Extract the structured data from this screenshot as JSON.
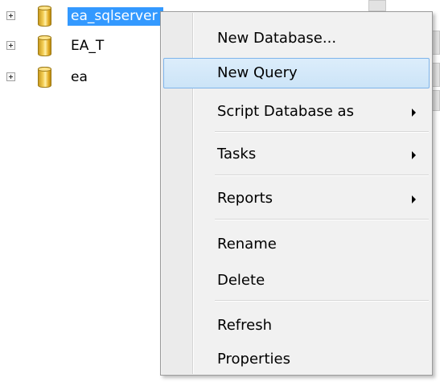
{
  "tree": {
    "nodes": [
      {
        "label": "ea_sqlserver",
        "selected": true
      },
      {
        "label": "EA_T",
        "selected": false
      },
      {
        "label": "ea",
        "selected": false
      }
    ]
  },
  "context_menu": {
    "items": [
      {
        "label": "New Database...",
        "has_submenu": false
      },
      {
        "label": "New Query",
        "has_submenu": false,
        "highlighted": true
      },
      {
        "label": "Script Database as",
        "has_submenu": true
      },
      {
        "label": "Tasks",
        "has_submenu": true
      },
      {
        "label": "Reports",
        "has_submenu": true
      },
      {
        "label": "Rename",
        "has_submenu": false
      },
      {
        "label": "Delete",
        "has_submenu": false
      },
      {
        "label": "Refresh",
        "has_submenu": false
      },
      {
        "label": "Properties",
        "has_submenu": false
      }
    ]
  },
  "colors": {
    "selection": "#3399ff",
    "menu_highlight": "#cce4f7",
    "menu_highlight_border": "#7eb4ea",
    "menu_background": "#f1f1f1"
  }
}
